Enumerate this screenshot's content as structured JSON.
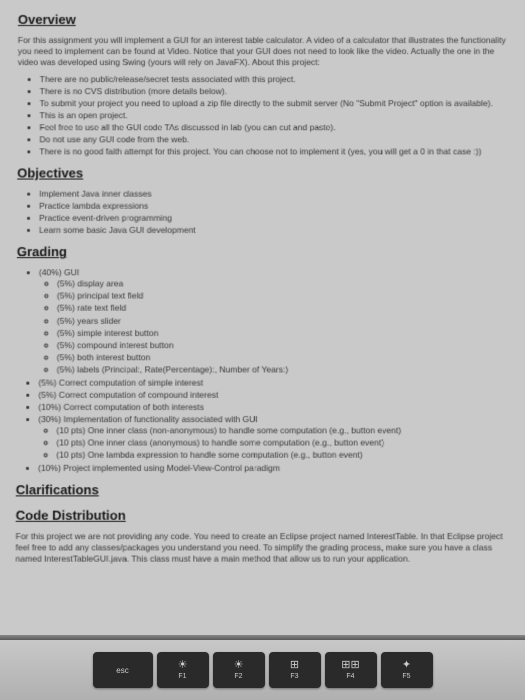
{
  "overview": {
    "heading": "Overview",
    "intro": "For this assignment you will implement a GUI for an interest table calculator. A video of a calculator that illustrates the functionality you need to implement can be found at Video. Notice that your GUI does not need to look like the video. Actually the one in the video was developed using Swing (yours will rely on JavaFX). About this project:",
    "bullets": [
      "There are no public/release/secret tests associated with this project.",
      "There is no CVS distribution (more details below).",
      "To submit your project you need to upload a zip file directly to the submit server (No \"Submit Project\" option is available).",
      "This is an open project.",
      "Feel free to use all the GUI code TAs discussed in lab (you can cut and paste).",
      "Do not use any GUI code from the web.",
      "There is no good faith attempt for this project. You can choose not to implement it (yes, you will get a 0 in that case :))"
    ]
  },
  "objectives": {
    "heading": "Objectives",
    "bullets": [
      "Implement Java inner classes",
      "Practice lambda expressions",
      "Practice event-driven programming",
      "Learn some basic Java GUI development"
    ]
  },
  "grading": {
    "heading": "Grading",
    "gui_label": "(40%) GUI",
    "gui_items": [
      "(5%) display area",
      "(5%) principal text field",
      "(5%) rate text field",
      "(5%) years slider",
      "(5%) simple interest button",
      "(5%) compound interest button",
      "(5%) both interest button",
      "(5%) labels (Principal:, Rate(Percentage):, Number of Years:)"
    ],
    "second_items": [
      "(5%) Correct computation of simple interest",
      "(5%) Correct computation of compound interest",
      "(10%) Correct computation of both interests",
      "(30%) Implementation of functionality associated with GUI"
    ],
    "impl_items": [
      "(10 pts) One inner class (non-anonymous) to handle some computation (e.g., button event)",
      "(10 pts) One inner class (anonymous) to handle some computation (e.g., button event)",
      "(10 pts) One lambda expression to handle some computation (e.g., button event)"
    ],
    "last_item": "(10%) Project implemented using Model-View-Control paradigm"
  },
  "clarifications": {
    "heading": "Clarifications"
  },
  "code_dist": {
    "heading": "Code Distribution",
    "text": "For this project we are not providing any code. You need to create an Eclipse project named InterestTable. In that Eclipse project feel free to add any classes/packages you understand you need. To simplify the grading process, make sure you have a class named InterestTableGUI.java. This class must have a main method that allow us to run your application."
  },
  "keys": {
    "esc": "esc",
    "f1": "F1",
    "f1_icon": "☀",
    "f2": "F2",
    "f2_icon": "☀",
    "f3": "F3",
    "f3_icon": "⊞",
    "f4": "F4",
    "f4_icon": "⊞⊞",
    "f5": "F5",
    "f5_icon": "✦"
  }
}
